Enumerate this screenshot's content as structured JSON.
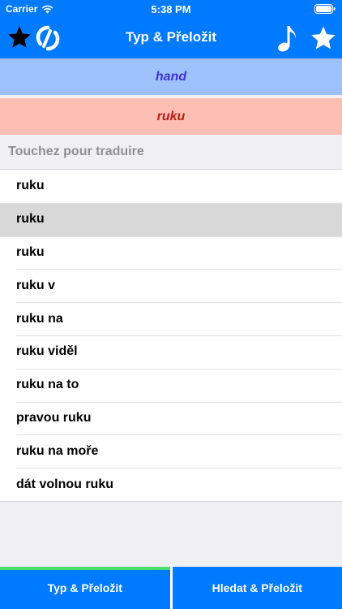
{
  "status_bar": {
    "carrier": "Carrier",
    "time": "5:38 PM"
  },
  "nav": {
    "title": "Typ & Přeložit",
    "left_icons": [
      "star-icon",
      "swap-logo-icon"
    ],
    "right_icons": [
      "music-note-icon",
      "star-icon"
    ]
  },
  "source_text": "hand",
  "translated_text": "ruku",
  "suggestions": {
    "header": "Touchez pour traduire",
    "items": [
      "ruku",
      "ruku",
      "ruku",
      "ruku v",
      "ruku na",
      "ruku viděl",
      "ruku na to",
      "pravou ruku",
      "ruku na moře",
      "dát volnou ruku"
    ],
    "selected_index": 1
  },
  "tabs": [
    {
      "label": "Typ & Přeložit",
      "active": true
    },
    {
      "label": "Hledat & Přeložit",
      "active": false
    }
  ],
  "colors": {
    "accent": "#007aff",
    "source_bg": "#9ec0fb",
    "source_text": "#3a34d6",
    "target_bg": "#fcbdb2",
    "target_text": "#b61f14",
    "active_tab_indicator": "#44e06a"
  }
}
